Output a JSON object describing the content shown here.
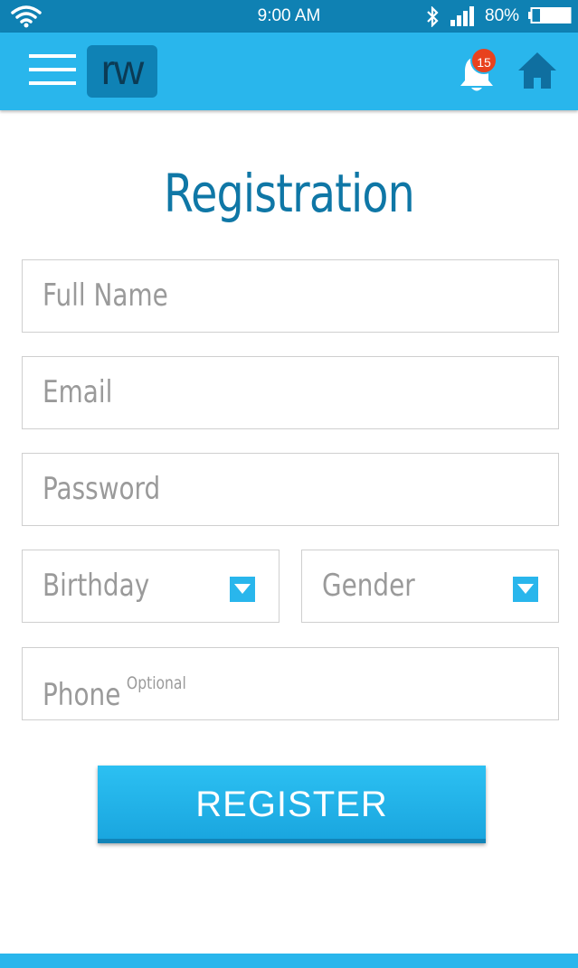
{
  "status_bar": {
    "time": "9:00 AM",
    "battery_percent": "80%",
    "battery_level": 0.8,
    "icons": [
      "wifi-icon",
      "bluetooth-icon",
      "signal-icon",
      "battery-icon"
    ]
  },
  "app_bar": {
    "logo_text": "rw",
    "notification_count": "15",
    "icons": [
      "menu-icon",
      "bell-icon",
      "home-icon"
    ],
    "colors": {
      "bar": "#29b6ec",
      "status": "#0f81b3",
      "logo_bg": "#0f82b5",
      "badge": "#e8421e"
    }
  },
  "form": {
    "title": "Registration",
    "full_name": {
      "value": "",
      "placeholder": "Full Name"
    },
    "email": {
      "value": "",
      "placeholder": "Email"
    },
    "password": {
      "value": "",
      "placeholder": "Password"
    },
    "birthday": {
      "selected": "Birthday"
    },
    "gender": {
      "selected": "Gender"
    },
    "phone": {
      "value": "",
      "placeholder": "Phone",
      "hint": "Optional"
    },
    "submit_label": "REGISTER"
  }
}
